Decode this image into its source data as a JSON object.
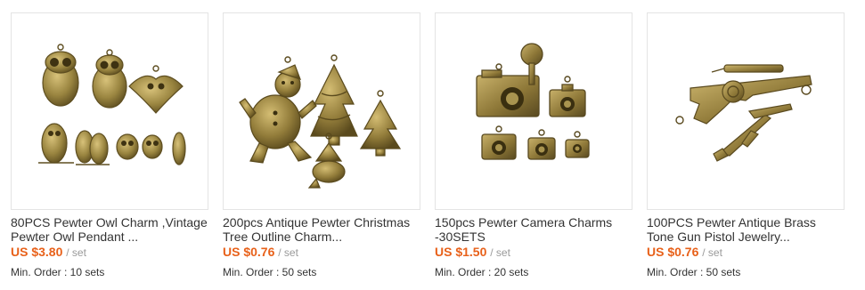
{
  "products": [
    {
      "title_line1": "80PCS Pewter Owl Charm ,Vintage",
      "title_line2": "Pewter Owl Pendant ...",
      "price": "US $3.80",
      "unit": "/ set",
      "min_order": "Min. Order : 10 sets",
      "image": "owl-charms-image"
    },
    {
      "title_line1": "200pcs Antique Pewter Christmas",
      "title_line2": "Tree Outline Charm...",
      "price": "US $0.76",
      "unit": "/ set",
      "min_order": "Min. Order : 50 sets",
      "image": "christmas-charms-image"
    },
    {
      "title_line1": "150pcs Pewter Camera Charms",
      "title_line2": "-30SETS",
      "price": "US $1.50",
      "unit": "/ set",
      "min_order": "Min. Order : 20 sets",
      "image": "camera-charms-image"
    },
    {
      "title_line1": "100PCS Pewter Antique Brass",
      "title_line2": "Tone Gun Pistol Jewelry...",
      "price": "US $0.76",
      "unit": "/ set",
      "min_order": "Min. Order : 50 sets",
      "image": "gun-charms-image"
    }
  ],
  "colors": {
    "price": "#e8611a",
    "brass": "#9a8540",
    "brass_dark": "#6b5a26",
    "text": "#333333",
    "muted": "#999999",
    "border": "#e4e4e4"
  }
}
